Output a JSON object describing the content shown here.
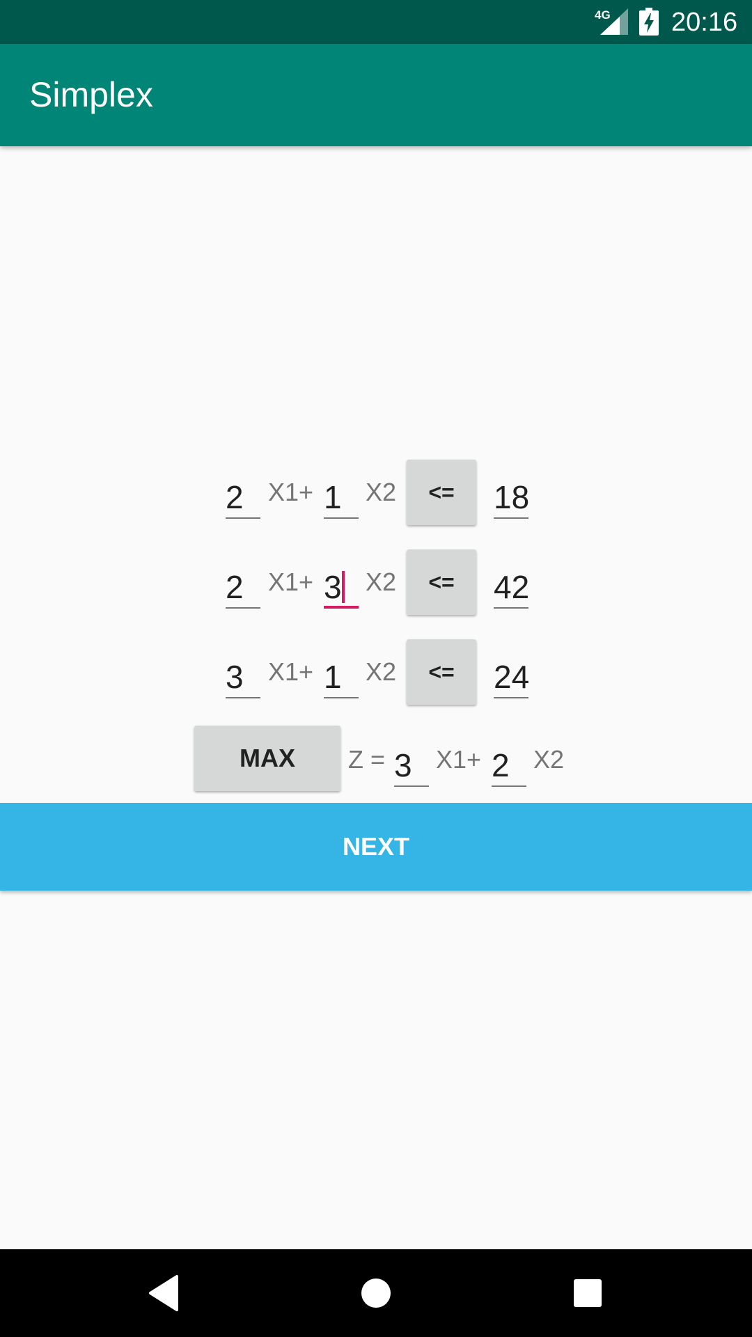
{
  "status_bar": {
    "network": "4G",
    "time": "20:16",
    "icons": [
      "signal-icon",
      "battery-charging-icon"
    ]
  },
  "app_bar": {
    "title": "Simplex"
  },
  "constraints": [
    {
      "a1": "2",
      "x1_label": "X1+",
      "a2": "1",
      "x2_label": "X2",
      "operator": "<=",
      "rhs": "18"
    },
    {
      "a1": "2",
      "x1_label": "X1+",
      "a2": "3",
      "x2_label": "X2",
      "operator": "<=",
      "rhs": "42"
    },
    {
      "a1": "3",
      "x1_label": "X1+",
      "a2": "1",
      "x2_label": "X2",
      "operator": "<=",
      "rhs": "24"
    }
  ],
  "objective": {
    "mode": "MAX",
    "z_label": "Z =",
    "c1": "3",
    "x1_label": "X1+",
    "c2": "2",
    "x2_label": "X2"
  },
  "next_button": {
    "label": "NEXT"
  },
  "nav_bar": {
    "icons": [
      "back-icon",
      "home-icon",
      "recents-icon"
    ]
  },
  "colors": {
    "status_bar": "#00574b",
    "app_bar": "#008577",
    "accent": "#d81b60",
    "next_button": "#35b5e5"
  }
}
